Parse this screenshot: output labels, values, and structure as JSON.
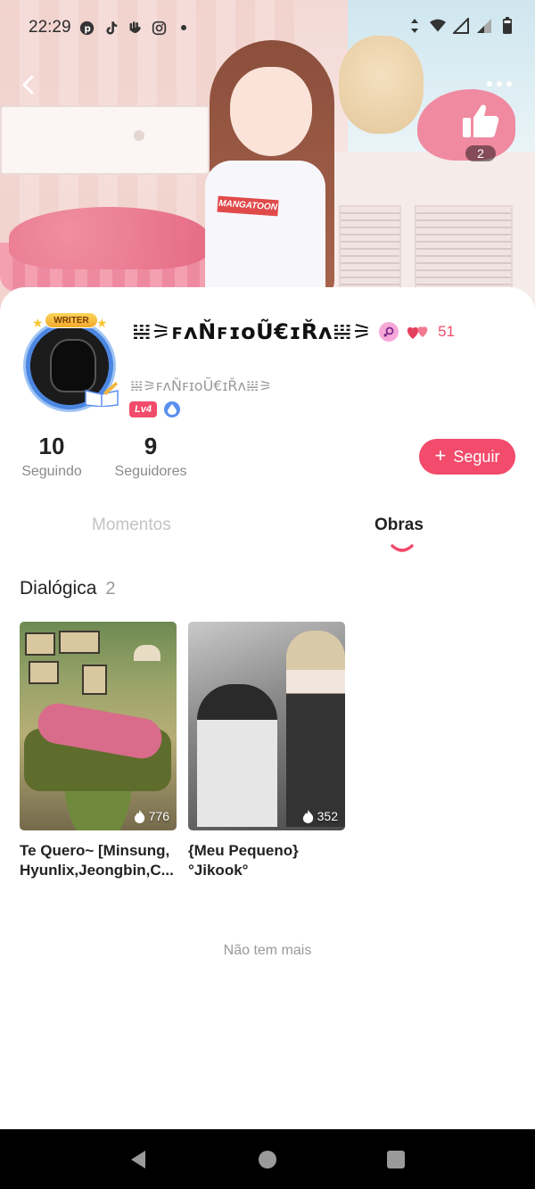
{
  "status_bar": {
    "time": "22:29",
    "left_icons": [
      "pinterest-icon",
      "tiktok-icon",
      "clubhouse-icon",
      "instagram-icon",
      "dot-icon"
    ],
    "right_icons": [
      "data-arrows-icon",
      "wifi-icon",
      "signal-icon",
      "signal-icon",
      "battery-icon"
    ]
  },
  "header": {
    "back_icon": "chevron-left-icon",
    "more_icon": "more-dots-icon",
    "like_icon": "thumbs-up-icon",
    "like_count": "2",
    "banner_shirt_text": "MANGATOON"
  },
  "profile": {
    "avatar_badge": "WRITER",
    "display_name": "𝍐⚞ꜰᴧŇꜰɪᴏŨ€ɪŘᴧ𝍐⚞",
    "gender_icon": "female-icon",
    "hearts_icon": "hearts-icon",
    "hearts_count": "51",
    "sub_name": "𝍐⚞ꜰᴧŇꜰɪᴏŨ€ɪŘᴧ𝍐⚞",
    "level_badge": "Lv4",
    "drop_badge_icon": "drop-icon"
  },
  "stats": {
    "following_count": "10",
    "following_label": "Seguindo",
    "followers_count": "9",
    "followers_label": "Seguidores"
  },
  "follow_button": {
    "label": "Seguir",
    "icon": "plus-icon"
  },
  "tabs": {
    "items": [
      {
        "label": "Momentos",
        "active": false
      },
      {
        "label": "Obras",
        "active": true
      }
    ]
  },
  "section": {
    "title": "Dialógica",
    "count": "2"
  },
  "works": [
    {
      "title": "Te Quero~ [Minsung, Hyunlix,Jeongbin,C...",
      "views": "776",
      "views_icon": "flame-icon"
    },
    {
      "title": "{Meu Pequeno} °Jikook°",
      "views": "352",
      "views_icon": "flame-icon"
    }
  ],
  "footer_text": "Não tem mais",
  "nav_bar": {
    "back_icon": "nav-back-icon",
    "home_icon": "nav-home-icon",
    "recent_icon": "nav-recent-icon"
  },
  "colors": {
    "accent": "#f24b6b",
    "text_primary": "#222222",
    "text_muted": "#9a9a9a",
    "tab_inactive": "#c3c3c3"
  }
}
